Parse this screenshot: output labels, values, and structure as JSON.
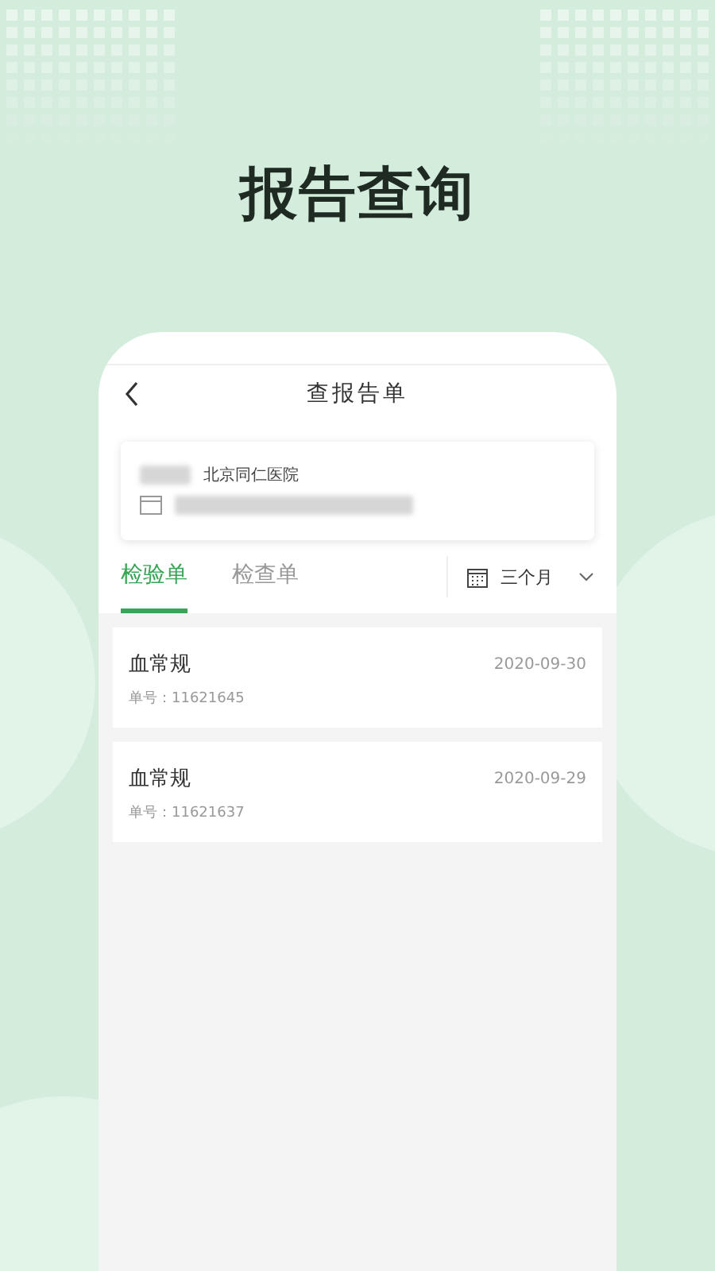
{
  "headline": "报告查询",
  "phone": {
    "title": "查报告单",
    "hospital": {
      "name": "北京同仁医院"
    },
    "tabs": [
      {
        "label": "检验单",
        "selected": true
      },
      {
        "label": "检查单",
        "selected": false
      }
    ],
    "period": {
      "label": "三个月"
    },
    "reports": [
      {
        "name": "血常规",
        "date": "2020-09-30",
        "number": "单号：11621645"
      },
      {
        "name": "血常规",
        "date": "2020-09-29",
        "number": "单号：11621637"
      }
    ]
  }
}
